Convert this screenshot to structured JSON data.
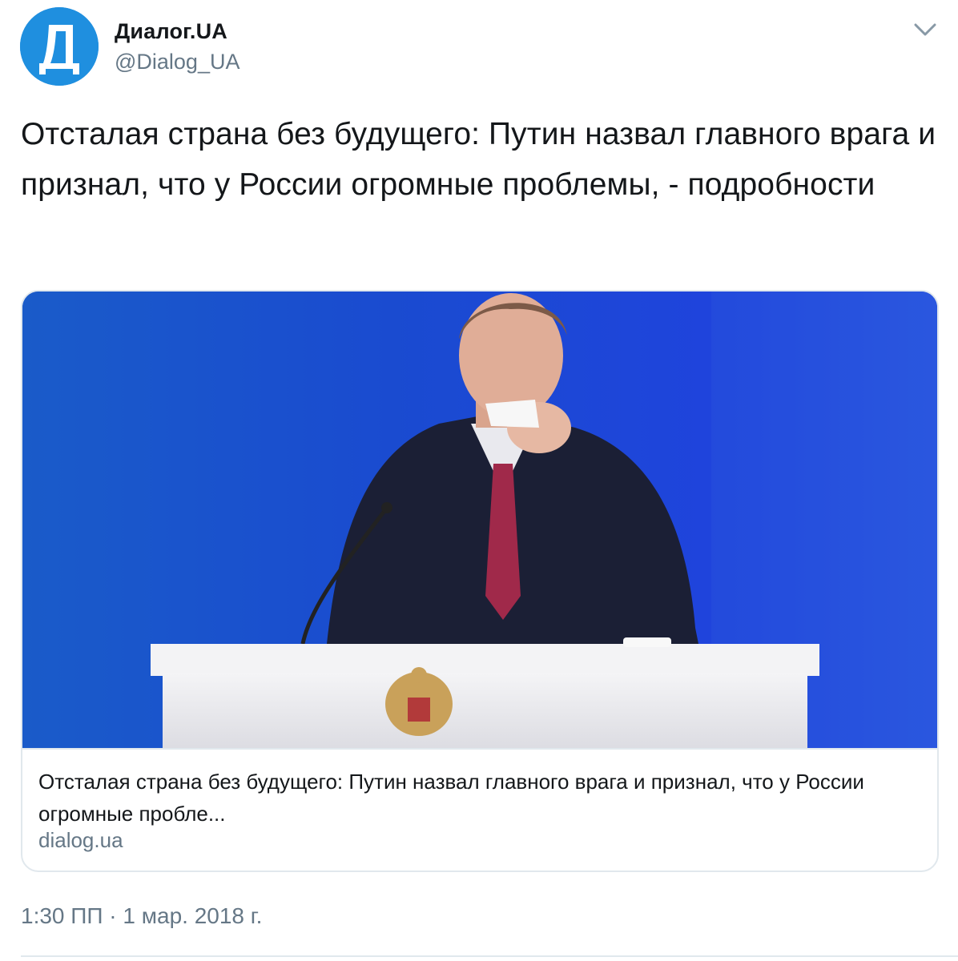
{
  "author": {
    "avatar_letter": "Д",
    "avatar_color": "#1f8fdf",
    "display_name": "Диалог.UA",
    "handle": "@Dialog_UA"
  },
  "menu": {
    "icon": "chevron-down-icon"
  },
  "tweet": {
    "text": "Отсталая страна без будущего: Путин назвал главного врага и признал, что у России огромные проблемы, - подробности"
  },
  "card": {
    "image_alt": "photo",
    "title": "Отсталая страна без будущего: Путин назвал главного врага и признал, что у России огромные пробле...",
    "domain": "dialog.ua"
  },
  "timestamp": "1:30 ПП · 1 мар. 2018 г."
}
